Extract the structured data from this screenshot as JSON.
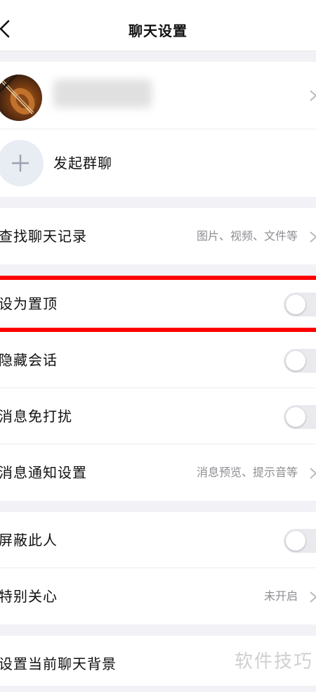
{
  "nav": {
    "title": "聊天设置"
  },
  "profile": {
    "start_group_chat": "发起群聊"
  },
  "search": {
    "label": "查找聊天记录",
    "value": "图片、视频、文件等"
  },
  "settings": {
    "pin": "设为置顶",
    "hide": "隐藏会话",
    "dnd": "消息免打扰",
    "notify": {
      "label": "消息通知设置",
      "value": "消息预览、提示音等"
    }
  },
  "privacy": {
    "block": "屏蔽此人",
    "special": {
      "label": "特别关心",
      "value": "未开启"
    }
  },
  "background": {
    "label": "设置当前聊天背景"
  },
  "watermark": "软件技巧",
  "toggles": {
    "pin": false,
    "hide": false,
    "dnd": false,
    "block": false
  }
}
